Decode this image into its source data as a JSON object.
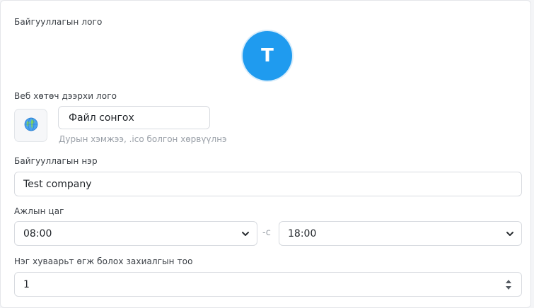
{
  "logo_section": {
    "label": "Байгууллагын лого",
    "initial": "T",
    "color": "#1f9bef"
  },
  "favicon_section": {
    "label": "Веб хөтөч дээрхи лого",
    "icon": "globe-icon",
    "file_button_label": "Файл сонгох",
    "hint": "Дурын хэмжээ, .ico болгон хөрвүүлнэ"
  },
  "company_name": {
    "label": "Байгууллагын нэр",
    "value": "Test company"
  },
  "working_hours": {
    "label": "Ажлын цаг",
    "start": "08:00",
    "separator": "-с",
    "end": "18:00"
  },
  "orders_per_slot": {
    "label": "Нэг хуваарьт өгж болох захиалгын тоо",
    "value": "1"
  }
}
